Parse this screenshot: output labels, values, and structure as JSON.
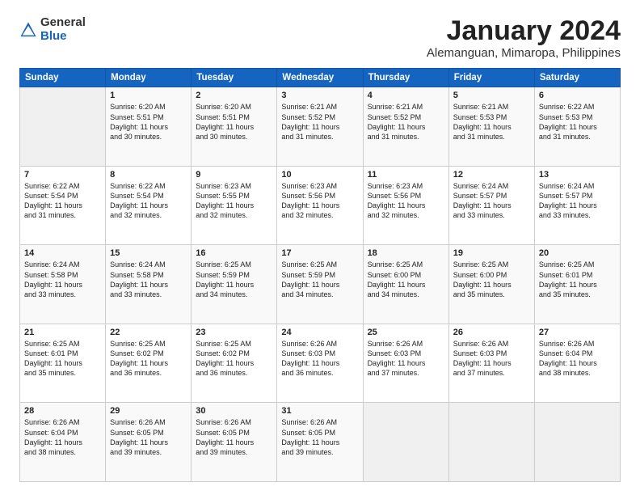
{
  "logo": {
    "general": "General",
    "blue": "Blue"
  },
  "calendar": {
    "title": "January 2024",
    "subtitle": "Alemanguan, Mimaropa, Philippines"
  },
  "days": [
    "Sunday",
    "Monday",
    "Tuesday",
    "Wednesday",
    "Thursday",
    "Friday",
    "Saturday"
  ],
  "weeks": [
    [
      {
        "day": "",
        "text": ""
      },
      {
        "day": "1",
        "text": "Sunrise: 6:20 AM\nSunset: 5:51 PM\nDaylight: 11 hours\nand 30 minutes."
      },
      {
        "day": "2",
        "text": "Sunrise: 6:20 AM\nSunset: 5:51 PM\nDaylight: 11 hours\nand 30 minutes."
      },
      {
        "day": "3",
        "text": "Sunrise: 6:21 AM\nSunset: 5:52 PM\nDaylight: 11 hours\nand 31 minutes."
      },
      {
        "day": "4",
        "text": "Sunrise: 6:21 AM\nSunset: 5:52 PM\nDaylight: 11 hours\nand 31 minutes."
      },
      {
        "day": "5",
        "text": "Sunrise: 6:21 AM\nSunset: 5:53 PM\nDaylight: 11 hours\nand 31 minutes."
      },
      {
        "day": "6",
        "text": "Sunrise: 6:22 AM\nSunset: 5:53 PM\nDaylight: 11 hours\nand 31 minutes."
      }
    ],
    [
      {
        "day": "7",
        "text": "Sunrise: 6:22 AM\nSunset: 5:54 PM\nDaylight: 11 hours\nand 31 minutes."
      },
      {
        "day": "8",
        "text": "Sunrise: 6:22 AM\nSunset: 5:54 PM\nDaylight: 11 hours\nand 32 minutes."
      },
      {
        "day": "9",
        "text": "Sunrise: 6:23 AM\nSunset: 5:55 PM\nDaylight: 11 hours\nand 32 minutes."
      },
      {
        "day": "10",
        "text": "Sunrise: 6:23 AM\nSunset: 5:56 PM\nDaylight: 11 hours\nand 32 minutes."
      },
      {
        "day": "11",
        "text": "Sunrise: 6:23 AM\nSunset: 5:56 PM\nDaylight: 11 hours\nand 32 minutes."
      },
      {
        "day": "12",
        "text": "Sunrise: 6:24 AM\nSunset: 5:57 PM\nDaylight: 11 hours\nand 33 minutes."
      },
      {
        "day": "13",
        "text": "Sunrise: 6:24 AM\nSunset: 5:57 PM\nDaylight: 11 hours\nand 33 minutes."
      }
    ],
    [
      {
        "day": "14",
        "text": "Sunrise: 6:24 AM\nSunset: 5:58 PM\nDaylight: 11 hours\nand 33 minutes."
      },
      {
        "day": "15",
        "text": "Sunrise: 6:24 AM\nSunset: 5:58 PM\nDaylight: 11 hours\nand 33 minutes."
      },
      {
        "day": "16",
        "text": "Sunrise: 6:25 AM\nSunset: 5:59 PM\nDaylight: 11 hours\nand 34 minutes."
      },
      {
        "day": "17",
        "text": "Sunrise: 6:25 AM\nSunset: 5:59 PM\nDaylight: 11 hours\nand 34 minutes."
      },
      {
        "day": "18",
        "text": "Sunrise: 6:25 AM\nSunset: 6:00 PM\nDaylight: 11 hours\nand 34 minutes."
      },
      {
        "day": "19",
        "text": "Sunrise: 6:25 AM\nSunset: 6:00 PM\nDaylight: 11 hours\nand 35 minutes."
      },
      {
        "day": "20",
        "text": "Sunrise: 6:25 AM\nSunset: 6:01 PM\nDaylight: 11 hours\nand 35 minutes."
      }
    ],
    [
      {
        "day": "21",
        "text": "Sunrise: 6:25 AM\nSunset: 6:01 PM\nDaylight: 11 hours\nand 35 minutes."
      },
      {
        "day": "22",
        "text": "Sunrise: 6:25 AM\nSunset: 6:02 PM\nDaylight: 11 hours\nand 36 minutes."
      },
      {
        "day": "23",
        "text": "Sunrise: 6:25 AM\nSunset: 6:02 PM\nDaylight: 11 hours\nand 36 minutes."
      },
      {
        "day": "24",
        "text": "Sunrise: 6:26 AM\nSunset: 6:03 PM\nDaylight: 11 hours\nand 36 minutes."
      },
      {
        "day": "25",
        "text": "Sunrise: 6:26 AM\nSunset: 6:03 PM\nDaylight: 11 hours\nand 37 minutes."
      },
      {
        "day": "26",
        "text": "Sunrise: 6:26 AM\nSunset: 6:03 PM\nDaylight: 11 hours\nand 37 minutes."
      },
      {
        "day": "27",
        "text": "Sunrise: 6:26 AM\nSunset: 6:04 PM\nDaylight: 11 hours\nand 38 minutes."
      }
    ],
    [
      {
        "day": "28",
        "text": "Sunrise: 6:26 AM\nSunset: 6:04 PM\nDaylight: 11 hours\nand 38 minutes."
      },
      {
        "day": "29",
        "text": "Sunrise: 6:26 AM\nSunset: 6:05 PM\nDaylight: 11 hours\nand 39 minutes."
      },
      {
        "day": "30",
        "text": "Sunrise: 6:26 AM\nSunset: 6:05 PM\nDaylight: 11 hours\nand 39 minutes."
      },
      {
        "day": "31",
        "text": "Sunrise: 6:26 AM\nSunset: 6:05 PM\nDaylight: 11 hours\nand 39 minutes."
      },
      {
        "day": "",
        "text": ""
      },
      {
        "day": "",
        "text": ""
      },
      {
        "day": "",
        "text": ""
      }
    ]
  ]
}
